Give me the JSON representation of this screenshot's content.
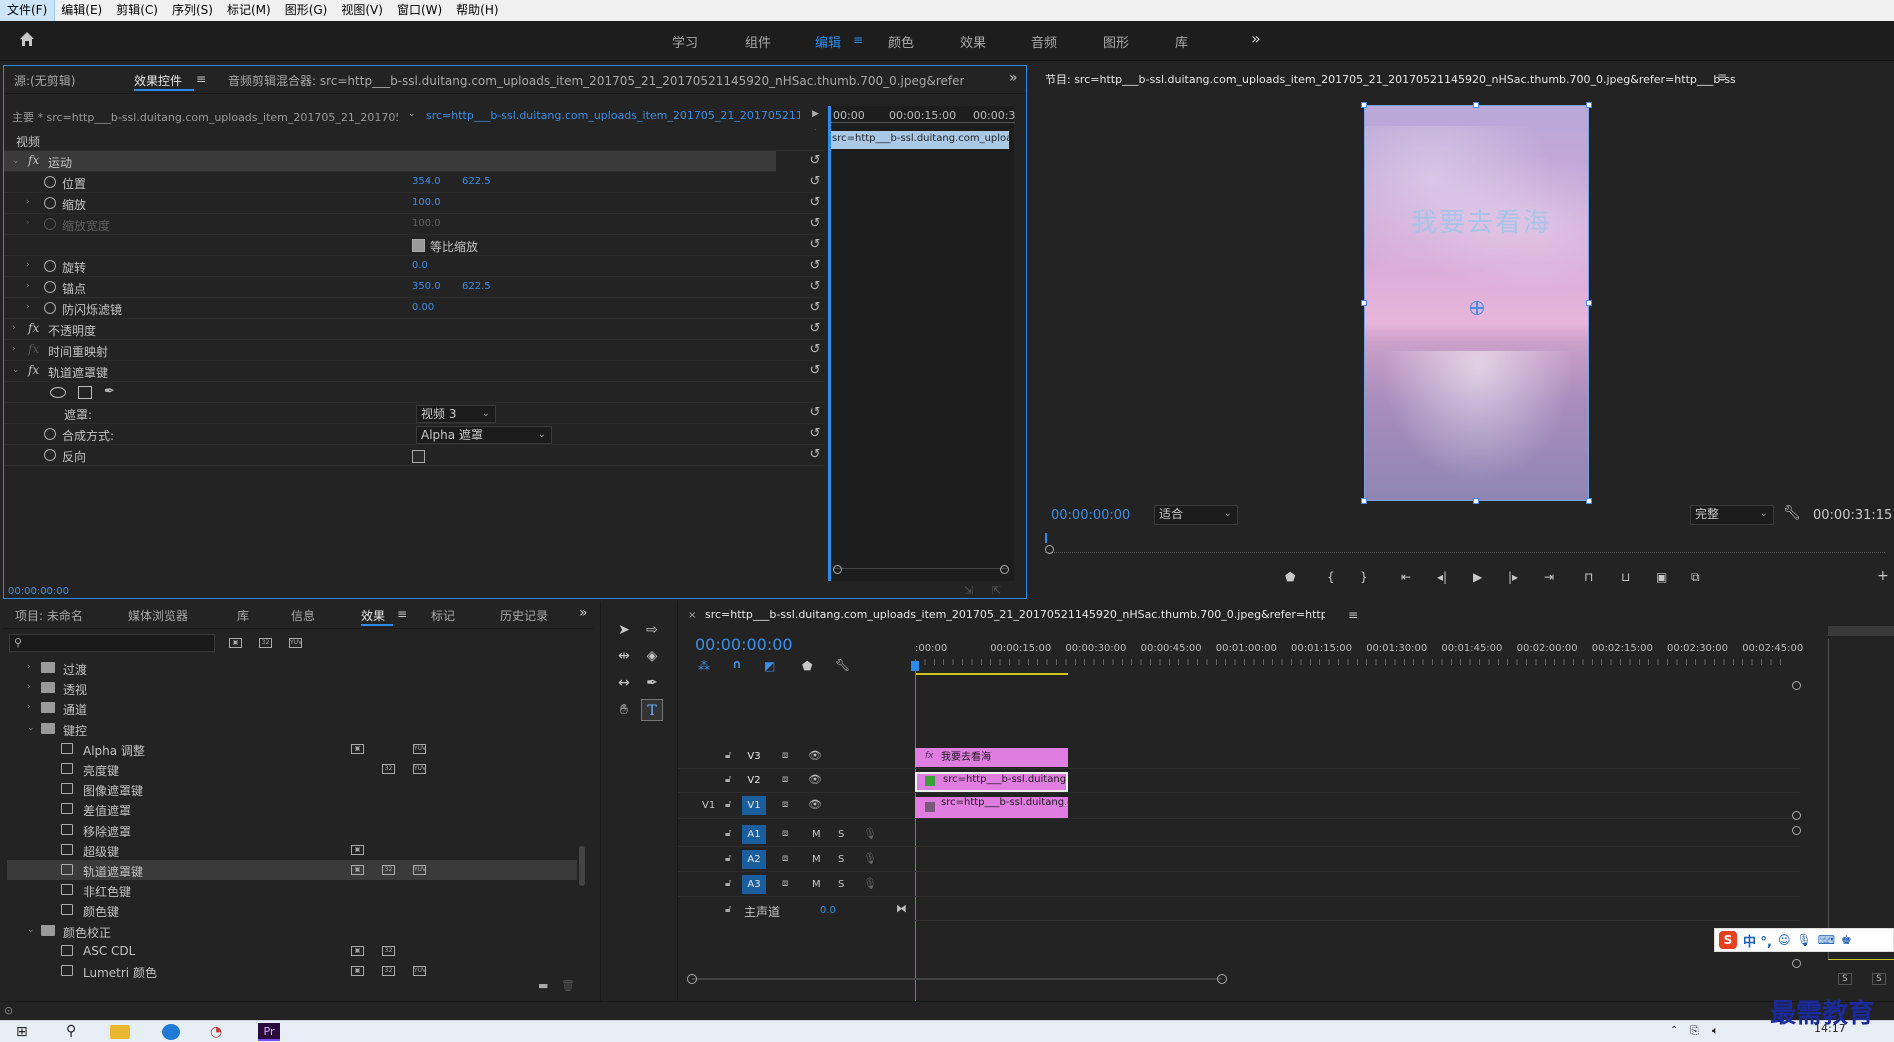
{
  "menu": [
    "文件(F)",
    "编辑(E)",
    "剪辑(C)",
    "序列(S)",
    "标记(M)",
    "图形(G)",
    "视图(V)",
    "窗口(W)",
    "帮助(H)"
  ],
  "workspaces": [
    "学习",
    "组件",
    "编辑",
    "颜色",
    "效果",
    "音频",
    "图形",
    "库"
  ],
  "effect_panel": {
    "tabs": {
      "source": "源:(无剪辑)",
      "effects_controls": "效果控件",
      "audio_mixer": "音频剪辑混合器: src=http___b-ssl.duitang.com_uploads_item_201705_21_20170521145920_nHSac.thumb.700_0.jpeg&refer=http___b-ssl.duitang"
    },
    "master": "主要 * src=http___b-ssl.duitang.com_uploads_item_201705_21_2017052111...",
    "clip": "src=http___b-ssl.duitang.com_uploads_item_201705_21_20170521145920...",
    "time_ruler": [
      "00:00",
      "00:00:15:00",
      "00:00:3"
    ],
    "mini_clip": "src=http___b-ssl.duitang.com_uploa",
    "section": "视频",
    "motion": "运动",
    "position_label": "位置",
    "position_x": "354.0",
    "position_y": "622.5",
    "scale_label": "缩放",
    "scale_value": "100.0",
    "scale_width_label": "缩放宽度",
    "scale_width_value": "100.0",
    "uniform_label": "等比缩放",
    "rotation_label": "旋转",
    "rotation_value": "0.0",
    "anchor_label": "锚点",
    "anchor_x": "350.0",
    "anchor_y": "622.5",
    "flicker_label": "防闪烁滤镜",
    "flicker_value": "0.00",
    "opacity": "不透明度",
    "time_remap": "时间重映射",
    "track_matte": "轨道遮罩键",
    "matte_label": "遮罩:",
    "matte_value": "视频 3",
    "composite_label": "合成方式:",
    "composite_value": "Alpha 遮罩",
    "reverse_label": "反向",
    "timecode": "00:00:00:00"
  },
  "program": {
    "title": "节目: src=http___b-ssl.duitang.com_uploads_item_201705_21_20170521145920_nHSac.thumb.700_0.jpeg&refer=http___b-ssl.duitang",
    "overlay_text": "我要去看海",
    "timecode": "00:00:00:00",
    "fit": "适合",
    "quality": "完整",
    "duration": "00:00:31:15"
  },
  "project": {
    "tabs": [
      "项目: 未命名",
      "媒体浏览器",
      "库",
      "信息",
      "效果",
      "标记",
      "历史记录"
    ],
    "effects_tab": "效果",
    "items": [
      {
        "label": "过渡",
        "type": "folder",
        "level": 1,
        "open": false
      },
      {
        "label": "透视",
        "type": "folder",
        "level": 1,
        "open": false
      },
      {
        "label": "通道",
        "type": "folder",
        "level": 1,
        "open": false
      },
      {
        "label": "键控",
        "type": "folder",
        "level": 1,
        "open": true
      },
      {
        "label": "Alpha 调整",
        "type": "preset",
        "level": 2,
        "badges": [
          1,
          0,
          1
        ]
      },
      {
        "label": "亮度键",
        "type": "preset",
        "level": 2,
        "badges": [
          0,
          1,
          1
        ]
      },
      {
        "label": "图像遮罩键",
        "type": "preset",
        "level": 2,
        "badges": [
          0,
          0,
          0
        ]
      },
      {
        "label": "差值遮罩",
        "type": "preset",
        "level": 2,
        "badges": [
          0,
          0,
          0
        ]
      },
      {
        "label": "移除遮罩",
        "type": "preset",
        "level": 2,
        "badges": [
          0,
          0,
          0
        ]
      },
      {
        "label": "超级键",
        "type": "preset",
        "level": 2,
        "badges": [
          1,
          0,
          0
        ]
      },
      {
        "label": "轨道遮罩键",
        "type": "preset",
        "level": 2,
        "badges": [
          1,
          1,
          1
        ],
        "selected": true
      },
      {
        "label": "非红色键",
        "type": "preset",
        "level": 2,
        "badges": [
          0,
          0,
          0
        ]
      },
      {
        "label": "颜色键",
        "type": "preset",
        "level": 2,
        "badges": [
          0,
          0,
          0
        ]
      },
      {
        "label": "颜色校正",
        "type": "folder",
        "level": 1,
        "open": true
      },
      {
        "label": "ASC CDL",
        "type": "preset",
        "level": 2,
        "badges": [
          1,
          1,
          0
        ]
      },
      {
        "label": "Lumetri 颜色",
        "type": "preset",
        "level": 2,
        "badges": [
          1,
          1,
          1
        ]
      }
    ]
  },
  "timeline": {
    "title": "src=http___b-ssl.duitang.com_uploads_item_201705_21_20170521145920_nHSac.thumb.700_0.jpeg&refer=http___b-ssl.duitang",
    "timecode": "00:00:00:00",
    "ruler": [
      ":00:00",
      "00:00:15:00",
      "00:00:30:00",
      "00:00:45:00",
      "00:01:00:00",
      "00:01:15:00",
      "00:01:30:00",
      "00:01:45:00",
      "00:02:00:00",
      "00:02:15:00",
      "00:02:30:00",
      "00:02:45:00"
    ],
    "video_tracks": [
      {
        "name": "V3",
        "src": ""
      },
      {
        "name": "V2",
        "src": ""
      },
      {
        "name": "V1",
        "src": "V1"
      }
    ],
    "audio_tracks": [
      "A1",
      "A2",
      "A3"
    ],
    "master": "主声道",
    "master_value": "0.0",
    "m": "M",
    "s": "S",
    "clips": {
      "v3": "我要去看海",
      "v2": "src=http___b-ssl.duitang.com",
      "v1": "src=http___b-ssl.duitang.com_"
    }
  },
  "meter": {
    "s": "S"
  },
  "taskbar": {
    "time": "14:17",
    "watermark": "最需教育",
    "pr": "Pr"
  },
  "ime": {
    "chars": "中 °,"
  }
}
